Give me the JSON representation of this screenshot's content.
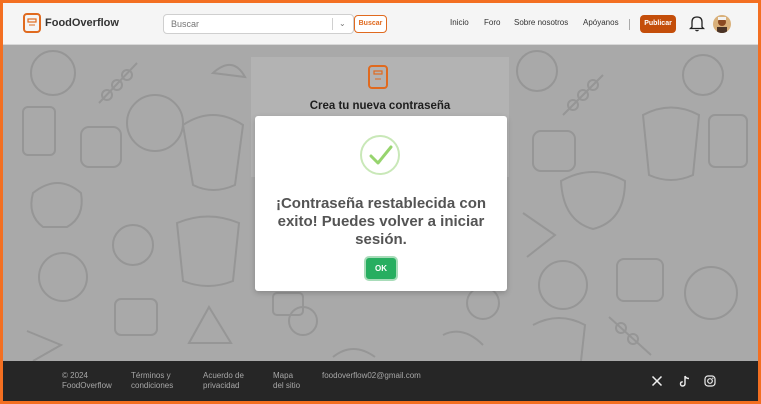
{
  "header": {
    "brand": "FoodOverflow",
    "search_placeholder": "Buscar",
    "search_button": "Buscar",
    "nav": [
      "Inicio",
      "Foro",
      "Sobre nosotros",
      "Apóyanos"
    ],
    "publish_button": "Publicar"
  },
  "card": {
    "title": "Crea tu nueva contraseña"
  },
  "modal": {
    "message": "¡Contraseña restablecida con exito! Puedes volver a iniciar sesión.",
    "ok_button": "OK"
  },
  "footer": {
    "copyright": "© 2024 FoodOverflow",
    "terms": "Términos y condiciones",
    "privacy": "Acuerdo de privacidad",
    "sitemap": "Mapa del sitio",
    "email": "foodoverflow02@gmail.com"
  },
  "colors": {
    "accent": "#e06a1f",
    "publish": "#c44e0a",
    "ok": "#27ae60",
    "footer_bg": "#262626",
    "frame": "#f36f21"
  },
  "icons": [
    "book-logo-icon",
    "chevron-down-icon",
    "bell-icon",
    "avatar",
    "check-icon",
    "x-icon",
    "tiktok-icon",
    "instagram-icon"
  ]
}
